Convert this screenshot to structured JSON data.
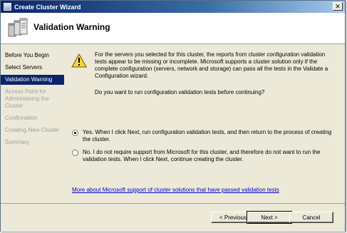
{
  "window": {
    "title": "Create Cluster Wizard"
  },
  "header": {
    "title": "Validation Warning",
    "icon": "cluster-servers-icon"
  },
  "sidebar": {
    "steps": [
      {
        "label": "Before You Begin",
        "state": "done"
      },
      {
        "label": "Select Servers",
        "state": "done"
      },
      {
        "label": "Validation Warning",
        "state": "current"
      },
      {
        "label": "Access Point for Administering the Cluster",
        "state": "pending"
      },
      {
        "label": "Confirmation",
        "state": "pending"
      },
      {
        "label": "Creating New Cluster",
        "state": "pending"
      },
      {
        "label": "Summary",
        "state": "pending"
      }
    ]
  },
  "content": {
    "warning_icon": "warning-triangle-icon",
    "warning_text": "For the servers you selected for this cluster, the reports from cluster configuration validation tests appear to be missing or incomplete.  Microsoft supports a cluster solution only if the complete configuration (servers, network and storage) can pass all the tests in the Validate a Configuration wizard.",
    "question": "Do you want to run configuration validation tests before continuing?",
    "options": [
      {
        "label": "Yes.  When I click Next, run configuration validation tests, and then return to the process of creating the cluster.",
        "selected": true
      },
      {
        "label": "No.  I do not require support from Microsoft for this cluster, and therefore do not want to run the validation tests.  When I click Next, continue creating the cluster.",
        "selected": false
      }
    ],
    "link_text": "More about Microsoft support of cluster solutions that have passed validation tests"
  },
  "footer": {
    "previous_label": "< Previous",
    "next_label": "Next >",
    "cancel_label": "Cancel"
  },
  "colors": {
    "title_bar": "#0a246a",
    "selected_step": "#0a246a",
    "link": "#0000cc"
  }
}
